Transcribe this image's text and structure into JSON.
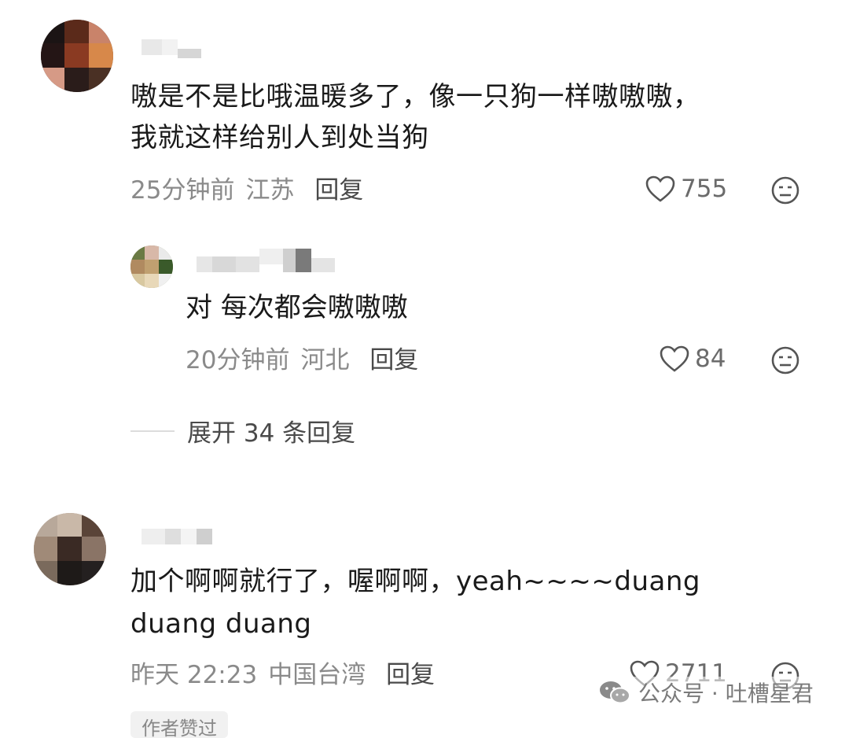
{
  "comments": [
    {
      "text_lines": [
        "嗷是不是比哦温暖多了，像一只狗一样嗷嗷嗷，",
        "我就这样给别人到处当狗"
      ],
      "time": "25分钟前",
      "location": "江苏",
      "reply_label": "回复",
      "likes": "755"
    },
    {
      "text_lines": [
        "加个啊啊就行了，喔啊啊，yeah~~~~duang",
        "duang duang"
      ],
      "time": "昨天 22:23",
      "location": "中国台湾",
      "reply_label": "回复",
      "likes": "2711"
    }
  ],
  "reply": {
    "text": "对 每次都会嗷嗷嗷",
    "time": "20分钟前",
    "location": "河北",
    "reply_label": "回复",
    "likes": "84"
  },
  "expand_label": "展开 34 条回复",
  "watermark": {
    "icon": "wechat-icon",
    "text": "公众号 · 吐槽星君"
  },
  "bottom_tag_partial": "作者赞过",
  "colors": {
    "text": "#1a1a1a",
    "meta": "#8a8a8a",
    "icon": "#555555"
  }
}
